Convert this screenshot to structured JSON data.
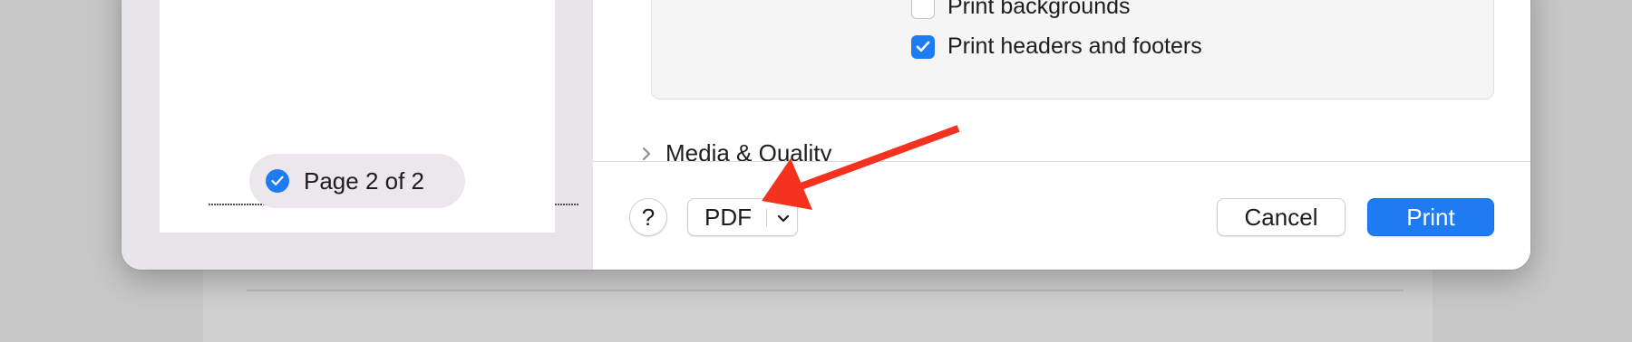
{
  "print_options": {
    "print_backgrounds": {
      "label": "Print backgrounds",
      "checked": false
    },
    "print_headers_footers": {
      "label": "Print headers and footers",
      "checked": true
    }
  },
  "sections": {
    "media_quality": "Media & Quality"
  },
  "preview": {
    "page_indicator": "Page 2 of 2"
  },
  "footer": {
    "help_label": "?",
    "pdf_label": "PDF",
    "cancel_label": "Cancel",
    "print_label": "Print"
  },
  "colors": {
    "accent": "#1f7bf2",
    "annotation_arrow": "#f4321f"
  },
  "icons": {
    "checkbox_checked": "checkmark-icon",
    "disclosure": "chevron-right-icon",
    "menu": "chevron-down-icon",
    "annotation": "red-arrow-icon"
  }
}
